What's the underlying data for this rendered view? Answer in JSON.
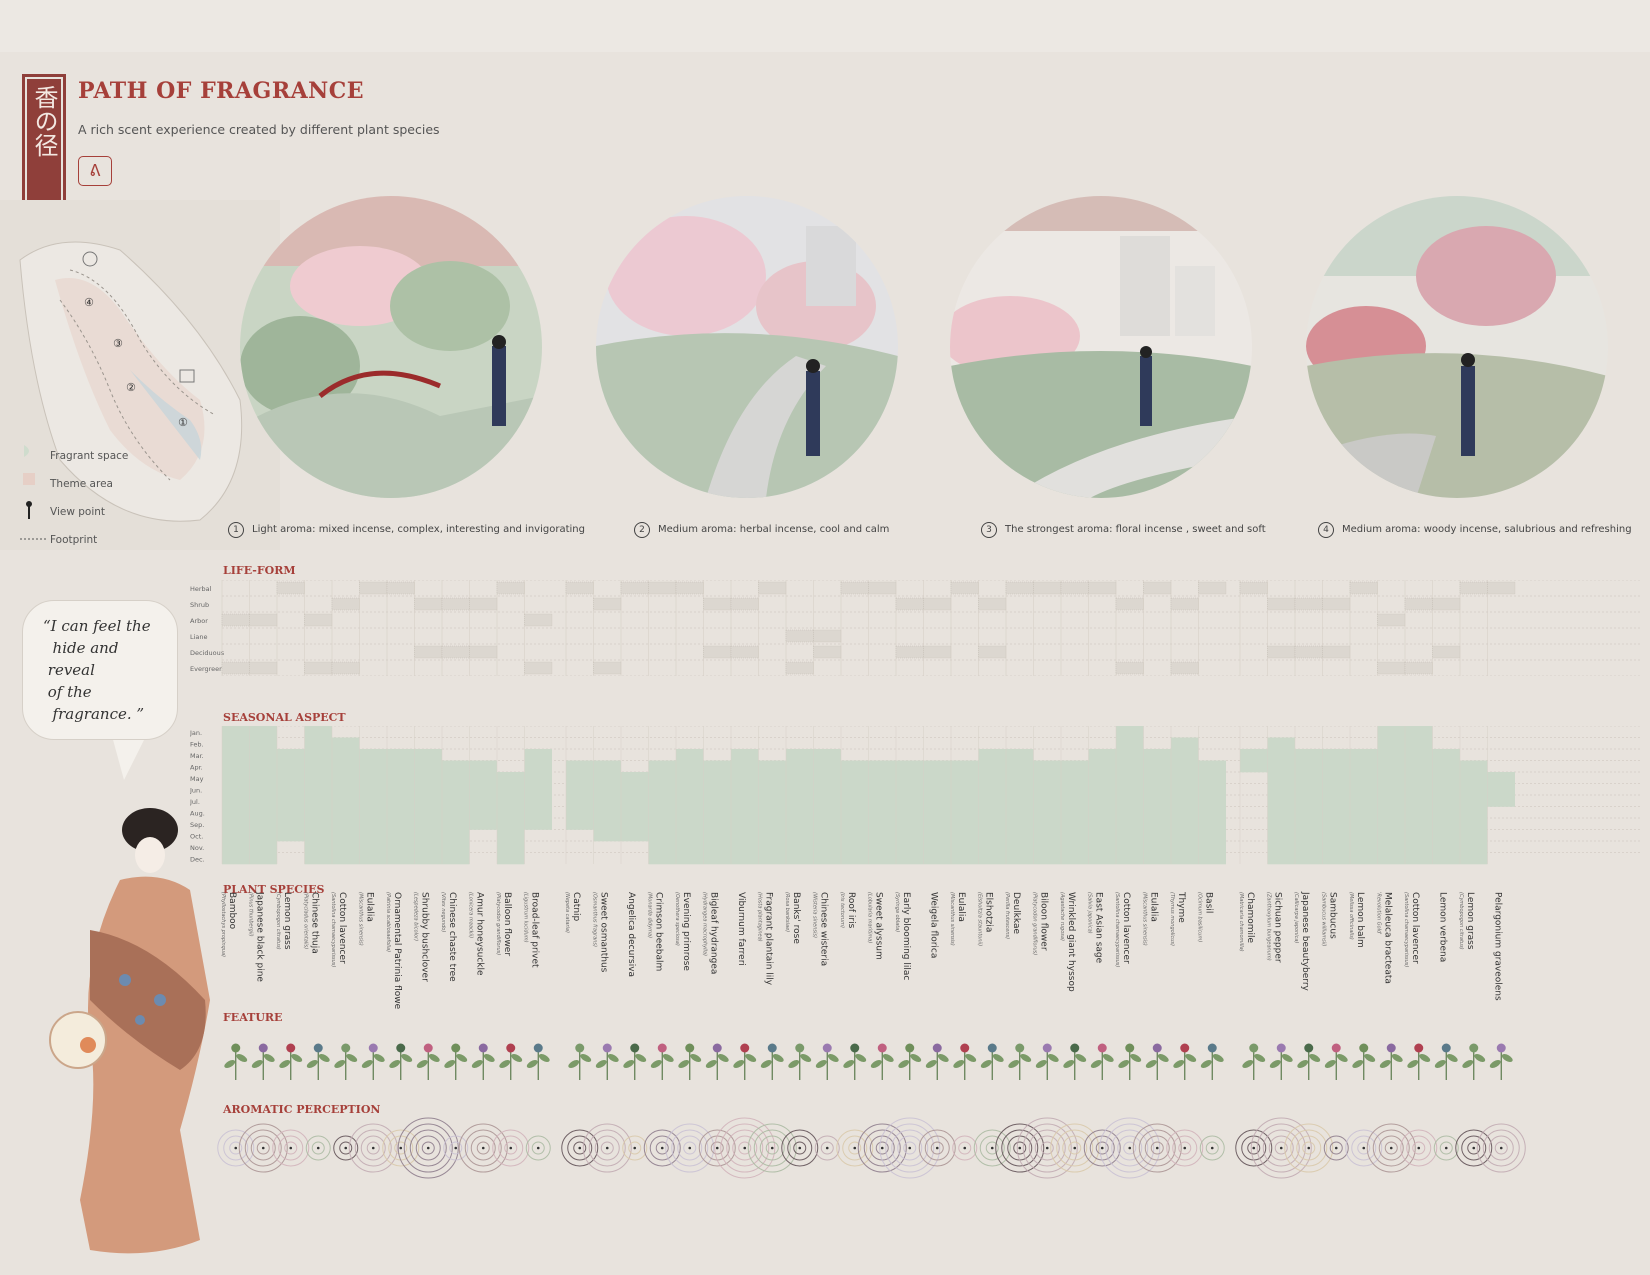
{
  "header": {
    "seal_text": "香の径",
    "title": "PATH OF FRAGRANCE",
    "subtitle": "A rich scent experience created by different plant species"
  },
  "map": {
    "legend": [
      "Fragrant space",
      "Theme area",
      "View point",
      "Footprint"
    ],
    "markers": [
      "①",
      "②",
      "③",
      "④"
    ]
  },
  "scenes": [
    {
      "num": "1",
      "text": "Light aroma:  mixed incense, complex, interesting and invigorating"
    },
    {
      "num": "2",
      "text": "Medium aroma:  herbal incense, cool and calm"
    },
    {
      "num": "3",
      "text": "The strongest aroma:  floral incense , sweet and soft"
    },
    {
      "num": "4",
      "text": "Medium aroma: woody incense, salubrious and refreshing"
    }
  ],
  "quote": "“I can feel the\n  hide and\n reveal\n of the\n  fragrance. ”",
  "sections": {
    "lifeform": "LIFE-FORM",
    "seasonal": "SEASONAL ASPECT",
    "species": "PLANT SPECIES",
    "feature": "FEATURE",
    "aromatic": "AROMATIC PERCEPTION"
  },
  "lifeform_rows": [
    "Herbal",
    "Shrub",
    "Arbor",
    "Liane",
    "Deciduous",
    "Evergreen"
  ],
  "months": [
    "Jan.",
    "Feb.",
    "Mar.",
    "Apr.",
    "May",
    "Jun.",
    "Jul.",
    "Aug.",
    "Sep.",
    "Oct.",
    "Nov.",
    "Dec."
  ],
  "colors": {
    "accent": "#a6403a",
    "season_fill": "#cbd8c9",
    "background": "#e8e3dd"
  },
  "chart_data": {
    "type": "heatmap",
    "note_columns": "plant species in display order",
    "species": [
      {
        "name": "Bamboo",
        "latin": "(Phyllostachys propinqua)",
        "lifeform": [
          "Arbor",
          "Evergreen"
        ],
        "months": [
          1,
          2,
          3,
          4,
          5,
          6,
          7,
          8,
          9,
          10,
          11,
          12
        ]
      },
      {
        "name": "Japanese black pine",
        "latin": "(Pinus thunbergii)",
        "lifeform": [
          "Arbor",
          "Evergreen"
        ],
        "months": [
          1,
          2,
          3,
          4,
          5,
          6,
          7,
          8,
          9,
          10,
          11,
          12
        ]
      },
      {
        "name": "Lemon grass",
        "latin": "(Cymbopogon citratus)",
        "lifeform": [
          "Herbal"
        ],
        "months": [
          3,
          4,
          5,
          6,
          7,
          8,
          9,
          10
        ]
      },
      {
        "name": "Chinese thuja",
        "latin": "(Platycladus orientalis)",
        "lifeform": [
          "Arbor",
          "Evergreen"
        ],
        "months": [
          1,
          2,
          3,
          4,
          5,
          6,
          7,
          8,
          9,
          10,
          11,
          12
        ]
      },
      {
        "name": "Cotton lavencer",
        "latin": "(Santolina chamaecyparissus)",
        "lifeform": [
          "Shrub",
          "Evergreen"
        ],
        "months": [
          2,
          3,
          4,
          5,
          6,
          7,
          8,
          9,
          10,
          11,
          12
        ]
      },
      {
        "name": "Eulalia",
        "latin": "(Miscanthus sinensis)",
        "lifeform": [
          "Herbal"
        ],
        "months": [
          3,
          4,
          5,
          6,
          7,
          8,
          9,
          10,
          11,
          12
        ]
      },
      {
        "name": "Ornamental Patrinia flowers",
        "latin": "(Patrinia scabiosaefolia)",
        "lifeform": [
          "Herbal"
        ],
        "months": [
          3,
          4,
          5,
          6,
          7,
          8,
          9,
          10,
          11,
          12
        ]
      },
      {
        "name": "Shrubby bushclover",
        "latin": "(Lespedeza bicolor)",
        "lifeform": [
          "Shrub",
          "Deciduous"
        ],
        "months": [
          3,
          4,
          5,
          6,
          7,
          8,
          9,
          10,
          11,
          12
        ]
      },
      {
        "name": "Chinese chaste tree",
        "latin": "(Vitex negundo)",
        "lifeform": [
          "Shrub",
          "Deciduous"
        ],
        "months": [
          4,
          5,
          6,
          7,
          8,
          9,
          10,
          11,
          12
        ]
      },
      {
        "name": "Amur honeysuckle",
        "latin": "(Lonicera maackii)",
        "lifeform": [
          "Shrub",
          "Deciduous"
        ],
        "months": [
          4,
          5,
          6,
          7,
          8,
          9
        ]
      },
      {
        "name": "Balloon flower",
        "latin": "(Platycodon grandiflorus)",
        "lifeform": [
          "Herbal"
        ],
        "months": [
          5,
          6,
          7,
          8,
          9,
          10,
          11,
          12
        ]
      },
      {
        "name": "Broad-leaf privet",
        "latin": "(Ligustrum lucidum)",
        "lifeform": [
          "Arbor",
          "Evergreen"
        ],
        "months": [
          3,
          4,
          5,
          6,
          7,
          8,
          9
        ]
      },
      {
        "name": "Catnip",
        "latin": "(Nepeta cataria)",
        "lifeform": [
          "Herbal"
        ],
        "months": [
          4,
          5,
          6,
          7,
          8,
          9
        ]
      },
      {
        "name": "Sweet osmanthus",
        "latin": "(Osmanthus fragrans)",
        "lifeform": [
          "Shrub",
          "Evergreen"
        ],
        "months": [
          4,
          5,
          6,
          7,
          8,
          9,
          10
        ]
      },
      {
        "name": "Angelica decursiva",
        "latin": "",
        "lifeform": [
          "Herbal"
        ],
        "months": [
          5,
          6,
          7,
          8,
          9,
          10
        ]
      },
      {
        "name": "Crimson beebalm",
        "latin": "(Monarda didyma)",
        "lifeform": [
          "Herbal"
        ],
        "months": [
          4,
          5,
          6,
          7,
          8,
          9,
          10,
          11,
          12
        ]
      },
      {
        "name": "Evening primrose",
        "latin": "(Oenothera speciosa)",
        "lifeform": [
          "Herbal"
        ],
        "months": [
          3,
          4,
          5,
          6,
          7,
          8,
          9,
          10,
          11,
          12
        ]
      },
      {
        "name": "Bigleaf hydrangea",
        "latin": "(Hydrangea macrophylla)",
        "lifeform": [
          "Shrub",
          "Deciduous"
        ],
        "months": [
          4,
          5,
          6,
          7,
          8,
          9,
          10,
          11,
          12
        ]
      },
      {
        "name": "Viburnum farreri",
        "latin": "",
        "lifeform": [
          "Shrub",
          "Deciduous"
        ],
        "months": [
          3,
          4,
          5,
          6,
          7,
          8,
          9,
          10,
          11,
          12
        ]
      },
      {
        "name": "Fragrant plantain lily",
        "latin": "(Hosta plantaginea)",
        "lifeform": [
          "Herbal"
        ],
        "months": [
          4,
          5,
          6,
          7,
          8,
          9,
          10,
          11,
          12
        ]
      },
      {
        "name": "Banks' rose",
        "latin": "(Rosa banksiae)",
        "lifeform": [
          "Liane",
          "Evergreen"
        ],
        "months": [
          3,
          4,
          5,
          6,
          7,
          8,
          9,
          10,
          11,
          12
        ]
      },
      {
        "name": "Chinese wisteria",
        "latin": "(Wisteria sinensis)",
        "lifeform": [
          "Liane",
          "Deciduous"
        ],
        "months": [
          3,
          4,
          5,
          6,
          7,
          8,
          9,
          10,
          11,
          12
        ]
      },
      {
        "name": "Roof iris",
        "latin": "(Iris tectorum)",
        "lifeform": [
          "Herbal"
        ],
        "months": [
          4,
          5,
          6,
          7,
          8,
          9,
          10,
          11,
          12
        ]
      },
      {
        "name": "Sweet alyssum",
        "latin": "(Lobularia maritima)",
        "lifeform": [
          "Herbal"
        ],
        "months": [
          4,
          5,
          6,
          7,
          8,
          9,
          10,
          11,
          12
        ]
      },
      {
        "name": "Early blooming lilac",
        "latin": "(Syringa oblata)",
        "lifeform": [
          "Shrub",
          "Deciduous"
        ],
        "months": [
          4,
          5,
          6,
          7,
          8,
          9,
          10,
          11,
          12
        ]
      },
      {
        "name": "Weigela florica",
        "latin": "",
        "lifeform": [
          "Shrub",
          "Deciduous"
        ],
        "months": [
          4,
          5,
          6,
          7,
          8,
          9,
          10,
          11,
          12
        ]
      },
      {
        "name": "Eulalia",
        "latin": "(Miscanthus sinensis)",
        "lifeform": [
          "Herbal"
        ],
        "months": [
          4,
          5,
          6,
          7,
          8,
          9,
          10,
          11,
          12
        ]
      },
      {
        "name": "Elshotzia",
        "latin": "(Elsholtzia stauntonii)",
        "lifeform": [
          "Shrub",
          "Deciduous"
        ],
        "months": [
          3,
          4,
          5,
          6,
          7,
          8,
          9,
          10,
          11,
          12
        ]
      },
      {
        "name": "Deulkkae",
        "latin": "(Perilla frutescens)",
        "lifeform": [
          "Herbal"
        ],
        "months": [
          3,
          4,
          5,
          6,
          7,
          8,
          9,
          10,
          11,
          12
        ]
      },
      {
        "name": "Biloon flower",
        "latin": "(Platycodon grandiflorus)",
        "lifeform": [
          "Herbal"
        ],
        "months": [
          4,
          5,
          6,
          7,
          8,
          9,
          10,
          11,
          12
        ]
      },
      {
        "name": "Wrinkled giant hyssop",
        "latin": "(Agastache rugosa)",
        "lifeform": [
          "Herbal"
        ],
        "months": [
          4,
          5,
          6,
          7,
          8,
          9,
          10,
          11,
          12
        ]
      },
      {
        "name": "East Asian sage",
        "latin": "(Salvia japonica)",
        "lifeform": [
          "Herbal"
        ],
        "months": [
          3,
          4,
          5,
          6,
          7,
          8,
          9,
          10,
          11,
          12
        ]
      },
      {
        "name": "Cotton lavencer",
        "latin": "(Santolina chamaecyparissus)",
        "lifeform": [
          "Shrub",
          "Evergreen"
        ],
        "months": [
          1,
          2,
          3,
          4,
          5,
          6,
          7,
          8,
          9,
          10,
          11,
          12
        ]
      },
      {
        "name": "Eulalia",
        "latin": "(Miscanthus sinensis)",
        "lifeform": [
          "Herbal"
        ],
        "months": [
          3,
          4,
          5,
          6,
          7,
          8,
          9,
          10,
          11,
          12
        ]
      },
      {
        "name": "Thyme",
        "latin": "(Thymus mongolicus)",
        "lifeform": [
          "Shrub",
          "Evergreen"
        ],
        "months": [
          2,
          3,
          4,
          5,
          6,
          7,
          8,
          9,
          10,
          11,
          12
        ]
      },
      {
        "name": "Basil",
        "latin": "(Ocimum basilicum)",
        "lifeform": [
          "Herbal"
        ],
        "months": [
          4,
          5,
          6,
          7,
          8,
          9,
          10,
          11,
          12
        ]
      },
      {
        "name": "Chamomile",
        "latin": "(Matricaria chamomilla)",
        "lifeform": [
          "Herbal"
        ],
        "months": [
          3,
          4
        ]
      },
      {
        "name": "Sichuan pepper",
        "latin": "(Zanthoxylum bungeanum)",
        "lifeform": [
          "Shrub",
          "Deciduous"
        ],
        "months": [
          2,
          3,
          4,
          5,
          6,
          7,
          8,
          9,
          10,
          11,
          12
        ]
      },
      {
        "name": "Japanese beautyberry",
        "latin": "(Callicarpa japonica)",
        "lifeform": [
          "Shrub",
          "Deciduous"
        ],
        "months": [
          3,
          4,
          5,
          6,
          7,
          8,
          9,
          10,
          11,
          12
        ]
      },
      {
        "name": "Sambucus",
        "latin": "(Sambucus williamsii)",
        "lifeform": [
          "Shrub",
          "Deciduous"
        ],
        "months": [
          3,
          4,
          5,
          6,
          7,
          8,
          9,
          10,
          11,
          12
        ]
      },
      {
        "name": "Lemon balm",
        "latin": "(Melissa officinalis)",
        "lifeform": [
          "Herbal"
        ],
        "months": [
          3,
          4,
          5,
          6,
          7,
          8,
          9,
          10,
          11,
          12
        ]
      },
      {
        "name": "Melaleuca bracteata",
        "latin": "'Revolution Gold'",
        "lifeform": [
          "Arbor",
          "Evergreen"
        ],
        "months": [
          1,
          2,
          3,
          4,
          5,
          6,
          7,
          8,
          9,
          10,
          11,
          12
        ]
      },
      {
        "name": "Cotton lavencer",
        "latin": "(Santolina chamaecyparissus)",
        "lifeform": [
          "Shrub",
          "Evergreen"
        ],
        "months": [
          1,
          2,
          3,
          4,
          5,
          6,
          7,
          8,
          9,
          10,
          11,
          12
        ]
      },
      {
        "name": "Lemon verbena",
        "latin": "",
        "lifeform": [
          "Shrub",
          "Deciduous"
        ],
        "months": [
          3,
          4,
          5,
          6,
          7,
          8,
          9,
          10,
          11,
          12
        ]
      },
      {
        "name": "Lemon grass",
        "latin": "(Cymbopogon citratus)",
        "lifeform": [
          "Herbal"
        ],
        "months": [
          4,
          5,
          6,
          7,
          8,
          9,
          10,
          11,
          12
        ]
      },
      {
        "name": "Pelargonium graveolens",
        "latin": "",
        "lifeform": [
          "Herbal"
        ],
        "months": [
          5,
          6,
          7
        ]
      }
    ]
  }
}
